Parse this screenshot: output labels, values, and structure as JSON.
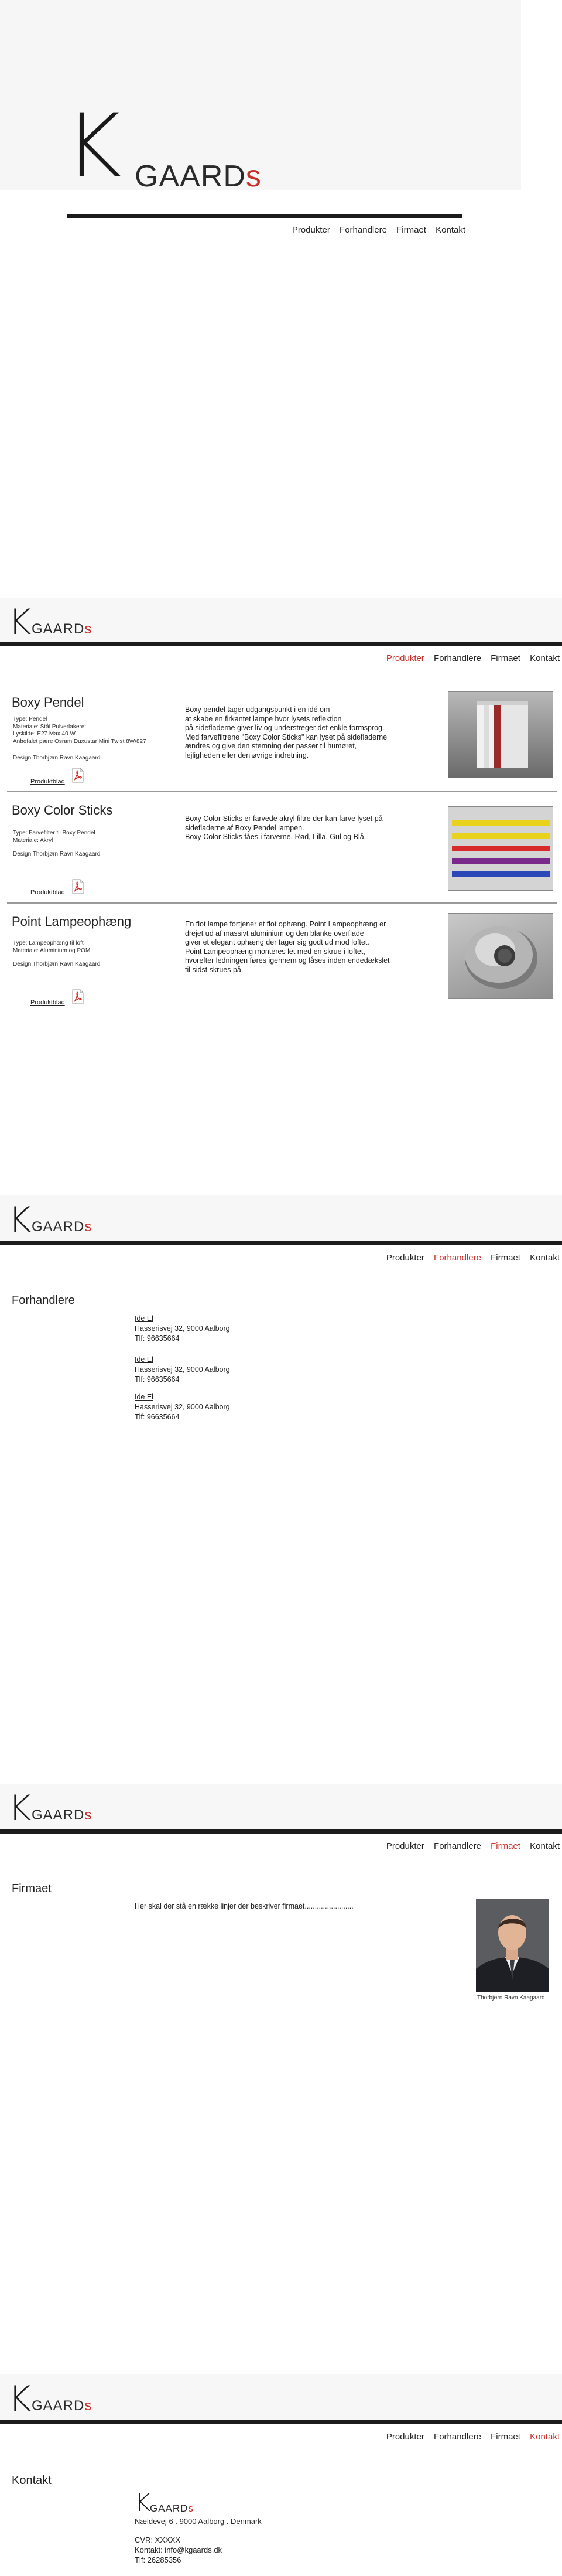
{
  "brand": {
    "k": "K",
    "rest": "GAARD",
    "s": "s",
    "accent_color": "#c8302a"
  },
  "nav": {
    "items": [
      "Produkter",
      "Forhandlere",
      "Firmaet",
      "Kontakt"
    ]
  },
  "products_section": {
    "items": [
      {
        "name": "Boxy Pendel",
        "meta": [
          "Type: Pendel",
          "Materiale: Stål Pulverlakeret",
          "Lyskilde: E27 Max 40 W",
          "Anbefalet pære Osram Duxustar Mini Twist 8W/827"
        ],
        "design": "Design Thorbjørn Ravn Kaagaard",
        "link": "Produktblad",
        "desc": [
          "Boxy pendel tager udgangspunkt i en idé om",
          "at skabe en firkantet lampe hvor lysets reflektion",
          "på sidefladerne giver liv og understreger det enkle formsprog.",
          "Med farvefiltrene \"Boxy Color Sticks\"  kan lyset på sidefladerne",
          "ændres og give den stemning der passer til humøret,",
          "lejligheden eller den øvrige indretning."
        ]
      },
      {
        "name": "Boxy Color Sticks",
        "meta": [
          "Type: Farvefilter til Boxy Pendel",
          "Materiale: Akryl"
        ],
        "design": "Design Thorbjørn Ravn Kaagaard",
        "link": "Produktblad",
        "desc": [
          "Boxy Color Sticks er farvede akryl filtre der kan farve lyset på",
          "sidefladerne af Boxy Pendel lampen.",
          "Boxy  Color Sticks fåes i farverne, Rød, Lilla, Gul og Blå."
        ]
      },
      {
        "name": "Point Lampeophæng",
        "meta": [
          "Type: Lampeophæng til loft",
          "Materiale: Aluminium og POM"
        ],
        "design": "Design Thorbjørn Ravn Kaagaard",
        "link": "Produktblad",
        "desc": [
          "En flot lampe fortjener et flot ophæng. Point Lampeophæng er",
          "drejet ud af massivt aluminium og den blanke overflade",
          "giver et elegant ophæng der tager sig godt ud mod loftet.",
          "Point Lampeophæng monteres let med en skrue i loftet,",
          "hvorefter ledningen føres igennem og låses inden endedækslet",
          "til sidst skrues på."
        ]
      }
    ],
    "stick_colors": [
      "#e8d21c",
      "#e8d21c",
      "#d82a2a",
      "#7a2a8a",
      "#2a48b8"
    ]
  },
  "dealers_section": {
    "title": "Forhandlere",
    "items": [
      {
        "name": "Ide El",
        "address": "Hasserisvej 32, 9000 Aalborg",
        "phone": "Tlf: 96635664"
      },
      {
        "name": "Ide El",
        "address": "Hasserisvej 32, 9000 Aalborg",
        "phone": "Tlf: 96635664"
      },
      {
        "name": "Ide El",
        "address": "Hasserisvej 32, 9000 Aalborg",
        "phone": "Tlf: 96635664"
      }
    ]
  },
  "company_section": {
    "title": "Firmaet",
    "text": "Her skal der stå en række linjer der beskriver firmaet........................",
    "portrait_caption": "Thorbjørn Ravn Kaagaard"
  },
  "contact_section": {
    "title": "Kontakt",
    "address": "Nældevej 6  .  9000 Aalborg  .  Denmark",
    "cvr": "CVR: XXXXX",
    "email": "Kontakt: info@kgaards.dk",
    "phone": "Tlf: 26285356"
  }
}
